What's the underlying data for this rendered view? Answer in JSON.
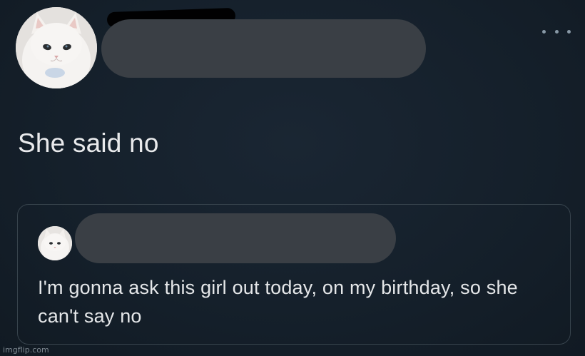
{
  "tweet": {
    "avatar_icon": "white-cat-avatar-icon",
    "more_icon": "more-options-icon",
    "text": "She said no"
  },
  "quoted_tweet": {
    "avatar_icon": "white-cat-avatar-icon",
    "text": "I'm gonna ask this girl out today, on my birthday, so she can't say no"
  },
  "watermark": "imgflip.com",
  "colors": {
    "background": "#15202b",
    "border": "#38444d",
    "text": "#e7e9ea",
    "redaction": "#3a3f45"
  }
}
